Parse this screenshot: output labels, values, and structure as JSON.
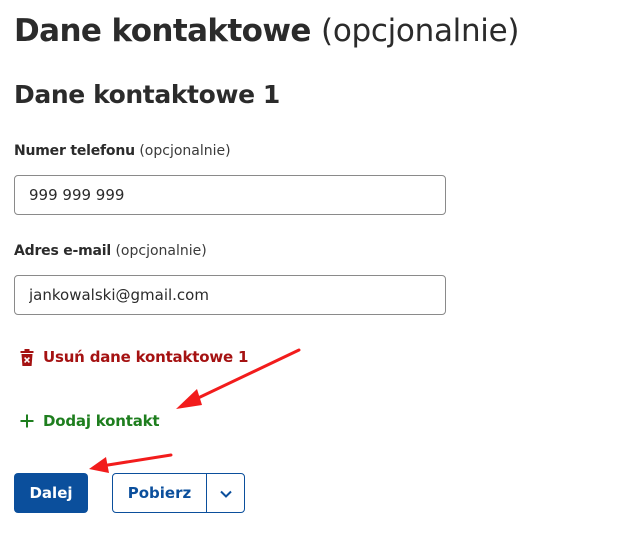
{
  "page": {
    "title": "Dane kontaktowe",
    "title_optional": "(opcjonalnie)"
  },
  "section": {
    "title": "Dane kontaktowe 1"
  },
  "phone": {
    "label": "Numer telefonu",
    "optional": "(opcjonalnie)",
    "value": "999 999 999"
  },
  "email": {
    "label": "Adres e-mail",
    "optional": "(opcjonalnie)",
    "value": "jankowalski@gmail.com"
  },
  "actions": {
    "remove_label": "Usuń dane kontaktowe 1",
    "add_label": "Dodaj kontakt",
    "next_label": "Dalej",
    "download_label": "Pobierz"
  },
  "icons": {
    "remove": "trash-icon",
    "add": "plus-icon",
    "dropdown": "chevron-down-icon"
  },
  "colors": {
    "primary": "#0b4f9c",
    "danger": "#a51212",
    "success": "#1e7e1e",
    "annotation_arrow": "#f21c1c"
  }
}
